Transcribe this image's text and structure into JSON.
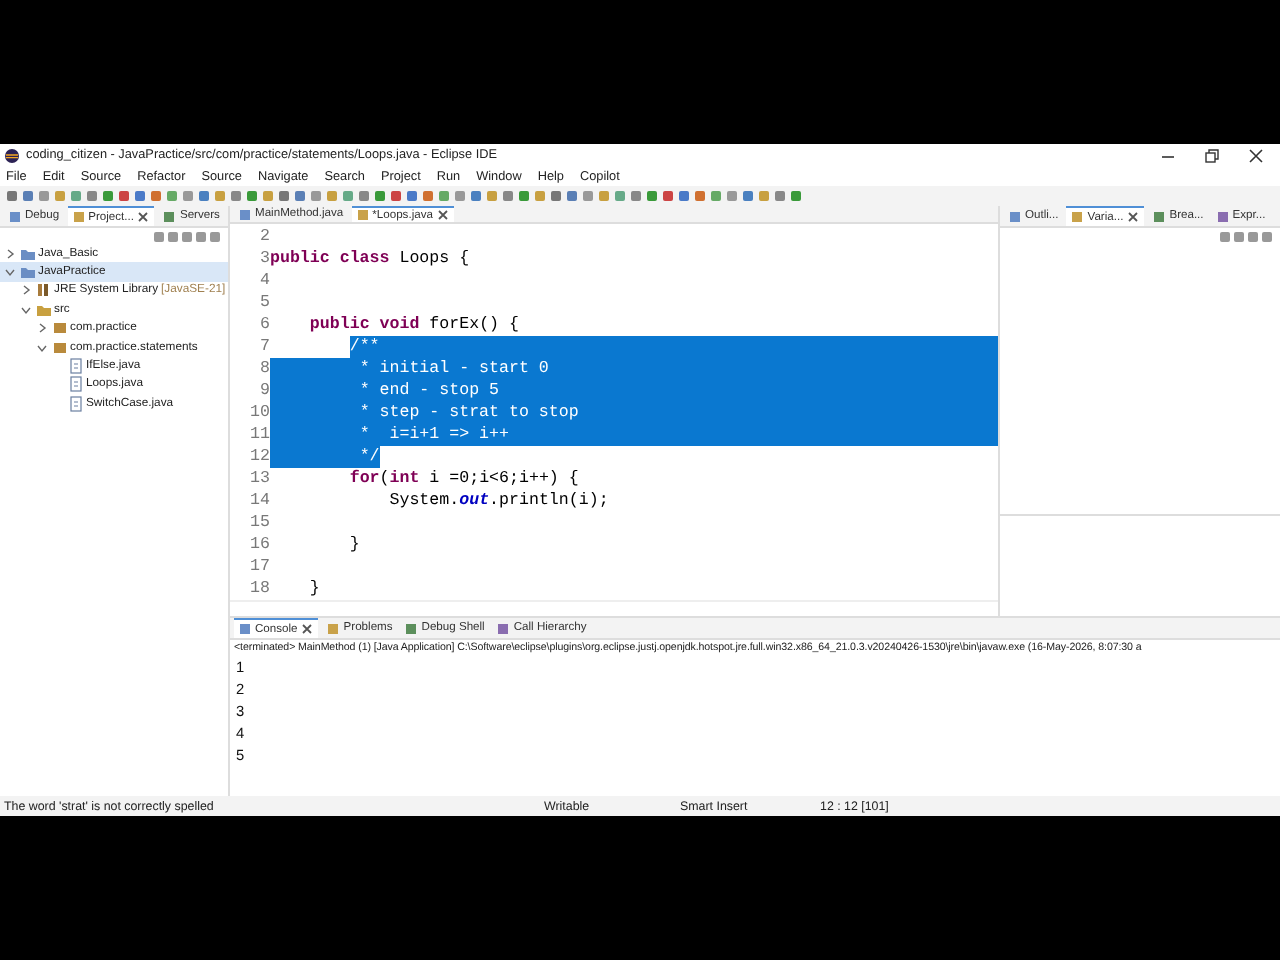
{
  "window": {
    "title": "coding_citizen - JavaPractice/src/com/practice/statements/Loops.java - Eclipse IDE"
  },
  "menu": [
    "File",
    "Edit",
    "Source",
    "Refactor",
    "Source",
    "Navigate",
    "Search",
    "Project",
    "Run",
    "Window",
    "Help",
    "Copilot"
  ],
  "left_view": {
    "tabs": [
      {
        "label": "Debug",
        "selected": false,
        "closable": false
      },
      {
        "label": "Project...",
        "selected": true,
        "closable": true
      },
      {
        "label": "Servers",
        "selected": false,
        "closable": false
      }
    ],
    "tree": [
      {
        "label": "Java_Basic",
        "kind": "project",
        "expanded": false,
        "selected": false
      },
      {
        "label": "JavaPractice",
        "kind": "project",
        "expanded": true,
        "selected": true,
        "children": [
          {
            "label": "JRE System Library",
            "decoration": "[JavaSE-21]",
            "kind": "library",
            "expanded": false,
            "selected": false
          },
          {
            "label": "src",
            "kind": "folder",
            "expanded": true,
            "selected": false,
            "children": [
              {
                "label": "com.practice",
                "kind": "package",
                "expanded": false,
                "selected": false
              },
              {
                "label": "com.practice.statements",
                "kind": "package",
                "expanded": true,
                "selected": false,
                "children": [
                  {
                    "label": "IfElse.java",
                    "kind": "file",
                    "selected": false
                  },
                  {
                    "label": "Loops.java",
                    "kind": "file",
                    "selected": false
                  },
                  {
                    "label": "SwitchCase.java",
                    "kind": "file",
                    "selected": false
                  }
                ]
              }
            ]
          }
        ]
      }
    ]
  },
  "editor": {
    "tabs": [
      {
        "label": "MainMethod.java",
        "selected": false,
        "closable": false
      },
      {
        "label": "*Loops.java",
        "selected": true,
        "closable": true
      }
    ],
    "lines": [
      {
        "number": "2",
        "selected": false
      },
      {
        "number": "3",
        "selected": false,
        "segments": [
          {
            "text": "public class",
            "kind": "keyword"
          },
          {
            "text": " Loops {",
            "kind": "plain"
          }
        ]
      },
      {
        "number": "4",
        "selected": false
      },
      {
        "number": "5",
        "selected": false
      },
      {
        "number": "6",
        "selected": false,
        "segments": [
          {
            "text": "    public void",
            "kind": "keyword"
          },
          {
            "text": " forEx() {",
            "kind": "plain"
          }
        ]
      },
      {
        "number": "7",
        "selected": true,
        "segments": [
          {
            "text": "        /**",
            "kind": "comment"
          }
        ]
      },
      {
        "number": "8",
        "selected": true,
        "segments": [
          {
            "text": "         * initial - start 0",
            "kind": "comment"
          }
        ]
      },
      {
        "number": "9",
        "selected": true,
        "segments": [
          {
            "text": "         * end - stop 5",
            "kind": "comment"
          }
        ]
      },
      {
        "number": "10",
        "selected": true,
        "segments": [
          {
            "text": "         * step - strat to stop",
            "kind": "comment"
          }
        ]
      },
      {
        "number": "11",
        "selected": true,
        "segments": [
          {
            "text": "         *  i=i+1 => i++",
            "kind": "comment"
          }
        ]
      },
      {
        "number": "12",
        "selected": true,
        "segments": [
          {
            "text": "         */",
            "kind": "comment"
          }
        ]
      },
      {
        "number": "13",
        "selected": false,
        "segments": [
          {
            "text": "        for",
            "kind": "keyword"
          },
          {
            "text": "(",
            "kind": "plain"
          },
          {
            "text": "int",
            "kind": "keyword"
          },
          {
            "text": " i =0;i<6;i++) {",
            "kind": "plain"
          }
        ]
      },
      {
        "number": "14",
        "selected": false,
        "segments": [
          {
            "text": "            System.",
            "kind": "plain"
          },
          {
            "text": "out",
            "kind": "field"
          },
          {
            "text": ".println(i);",
            "kind": "plain"
          }
        ]
      },
      {
        "number": "15",
        "selected": false
      },
      {
        "number": "16",
        "selected": false,
        "segments": [
          {
            "text": "        }",
            "kind": "plain"
          }
        ]
      },
      {
        "number": "17",
        "selected": false
      },
      {
        "number": "18",
        "selected": false,
        "segments": [
          {
            "text": "    }",
            "kind": "plain"
          }
        ]
      }
    ]
  },
  "right_view": {
    "tabs": [
      {
        "label": "Outli...",
        "selected": false,
        "closable": false
      },
      {
        "label": "Varia...",
        "selected": true,
        "closable": true
      },
      {
        "label": "Brea...",
        "selected": false,
        "closable": false
      },
      {
        "label": "Expr...",
        "selected": false,
        "closable": false
      }
    ]
  },
  "console": {
    "tabs": [
      {
        "label": "Console",
        "selected": true,
        "closable": true
      },
      {
        "label": "Problems",
        "selected": false,
        "closable": false
      },
      {
        "label": "Debug Shell",
        "selected": false,
        "closable": false
      },
      {
        "label": "Call Hierarchy",
        "selected": false,
        "closable": false
      }
    ],
    "header": "<terminated> MainMethod (1) [Java Application] C:\\Software\\eclipse\\plugins\\org.eclipse.justj.openjdk.hotspot.jre.full.win32.x86_64_21.0.3.v20240426-1530\\jre\\bin\\javaw.exe  (16-May-2026, 8:07:30 a",
    "output": [
      "1",
      "2",
      "3",
      "4",
      "5"
    ]
  },
  "status_bar": {
    "message": "The word 'strat' is not correctly spelled",
    "mode": "Writable",
    "insert": "Smart Insert",
    "position": "12 : 12 [101]"
  }
}
